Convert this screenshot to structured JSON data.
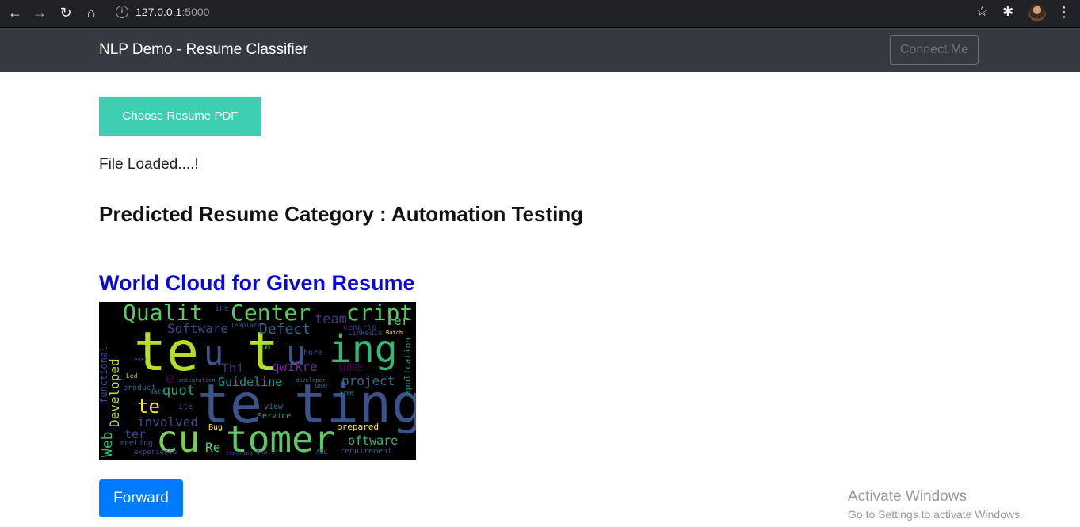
{
  "browser": {
    "url_host": "127.0.0.1",
    "url_port": ":5000"
  },
  "navbar": {
    "brand": "NLP Demo - Resume Classifier",
    "connect_label": "Connect Me"
  },
  "main": {
    "choose_label": "Choose Resume PDF",
    "status_text": "File Loaded....!",
    "prediction_text": "Predicted Resume Category : Automation Testing",
    "wordcloud_title": "World Cloud for Given Resume",
    "forward_label": "Forward"
  },
  "wordcloud_words": [
    {
      "text": "Qualit",
      "color": "#5ec962"
    },
    {
      "text": "Center",
      "color": "#5ec962"
    },
    {
      "text": "cript",
      "color": "#5ec962"
    },
    {
      "text": "te",
      "color": "#b5de2b"
    },
    {
      "text": "u",
      "color": "#3b528b"
    },
    {
      "text": "t",
      "color": "#b5de2b"
    },
    {
      "text": "u",
      "color": "#3b528b"
    },
    {
      "text": "ing",
      "color": "#35b779"
    },
    {
      "text": "te",
      "color": "#3b528b"
    },
    {
      "text": "ting",
      "color": "#3b528b"
    },
    {
      "text": "cu",
      "color": "#7ad151"
    },
    {
      "text": "tomer",
      "color": "#5ec962"
    },
    {
      "text": "Software",
      "color": "#3e4a89"
    },
    {
      "text": "Defect",
      "color": "#31688e"
    },
    {
      "text": "team",
      "color": "#443983"
    },
    {
      "text": "Thi",
      "color": "#482878"
    },
    {
      "text": "qwikre",
      "color": "#6b2b8e"
    },
    {
      "text": "ume",
      "color": "#440154"
    },
    {
      "text": "Guideline",
      "color": "#21918c"
    },
    {
      "text": "project",
      "color": "#31688e"
    },
    {
      "text": "Developed",
      "color": "#bddf26"
    },
    {
      "text": "functional",
      "color": "#3e4a89"
    },
    {
      "text": "quot",
      "color": "#20a486"
    },
    {
      "text": "te",
      "color": "#fde725"
    },
    {
      "text": "involved",
      "color": "#3b528b"
    },
    {
      "text": "Web",
      "color": "#35b779"
    },
    {
      "text": "ter",
      "color": "#3e4a89"
    },
    {
      "text": "Re",
      "color": "#5ec962"
    },
    {
      "text": "oftware",
      "color": "#35b779"
    },
    {
      "text": "prepared",
      "color": "#fde725"
    },
    {
      "text": "Service",
      "color": "#20a486"
    },
    {
      "text": "view",
      "color": "#2a788e"
    },
    {
      "text": "Bug",
      "color": "#fde725"
    },
    {
      "text": "meeting",
      "color": "#3b528b"
    },
    {
      "text": "experience",
      "color": "#3e4a89"
    },
    {
      "text": "requirement",
      "color": "#31688e"
    },
    {
      "text": "application",
      "color": "#21918c"
    },
    {
      "text": "cenario",
      "color": "#443983"
    },
    {
      "text": "LinkedIn",
      "color": "#3b528b"
    },
    {
      "text": "product",
      "color": "#31688e"
    },
    {
      "text": "data",
      "color": "#2a788e"
    },
    {
      "text": "Led",
      "color": "#b5de2b"
    },
    {
      "text": "level",
      "color": "#3e4a89"
    },
    {
      "text": "integration",
      "color": "#31688e"
    },
    {
      "text": "developer",
      "color": "#2a788e"
    },
    {
      "text": "Free",
      "color": "#21918c"
    },
    {
      "text": "tracking",
      "color": "#3b528b"
    },
    {
      "text": "Qualit",
      "color": "#3e4a89"
    },
    {
      "text": "ABC",
      "color": "#31688e"
    },
    {
      "text": "er",
      "color": "#5ec962"
    },
    {
      "text": "e",
      "color": "#440154"
    },
    {
      "text": "ite",
      "color": "#3b528b"
    },
    {
      "text": "ca",
      "color": "#5ec962"
    },
    {
      "text": "hore",
      "color": "#3e4a89"
    },
    {
      "text": "ine",
      "color": "#3b528b"
    },
    {
      "text": "Template",
      "color": "#3b528b"
    },
    {
      "text": "Batch",
      "color": "#fde725"
    },
    {
      "text": "ume",
      "color": "#31688e"
    }
  ]
}
